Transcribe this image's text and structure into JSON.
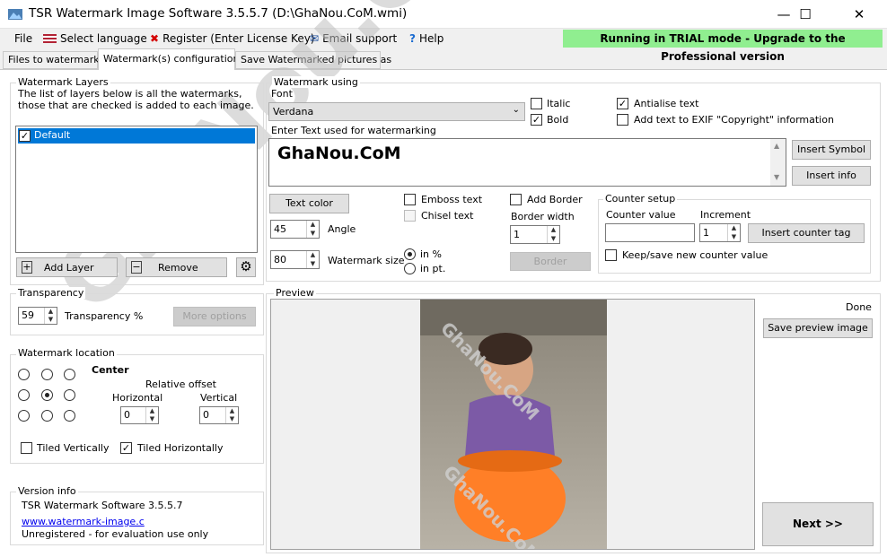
{
  "window": {
    "title": "TSR Watermark Image Software 3.5.5.7 (D:\\GhaNou.CoM.wmi)",
    "minimize": "—",
    "maximize": "☐",
    "close": "✕"
  },
  "menu": {
    "file": "File",
    "select_language": "Select language",
    "register": "Register (Enter License Key)",
    "email_support": "Email support",
    "help": "Help",
    "trial": "Running in TRIAL mode - Upgrade to the Professional version"
  },
  "tabs": [
    "Files to watermark",
    "Watermark(s) configuration",
    "Save Watermarked pictures as"
  ],
  "layers": {
    "group_label": "Watermark Layers",
    "description": "The list of layers below is all the watermarks, those that are checked is added to each image.",
    "items": [
      {
        "label": "Default",
        "checked": true
      }
    ],
    "add_layer": "Add Layer",
    "remove": "Remove"
  },
  "transparency": {
    "group_label": "Transparency",
    "value": "59",
    "label": "Transparency %",
    "more_options": "More options"
  },
  "location": {
    "group_label": "Watermark location",
    "position": "Center",
    "relative_offset": "Relative offset",
    "horizontal_label": "Horizontal",
    "horizontal_value": "0",
    "vertical_label": "Vertical",
    "vertical_value": "0",
    "tiled_vertically": "Tiled Vertically",
    "tiled_horizontally": "Tiled Horizontally"
  },
  "version": {
    "group_label": "Version info",
    "name": "TSR Watermark Software 3.5.5.7",
    "link": "www.watermark-image.c",
    "status": "Unregistered - for evaluation use only"
  },
  "using": {
    "group_label": "Watermark using",
    "font_label": "Font",
    "font_value": "Verdana",
    "italic": "Italic",
    "bold": "Bold",
    "antialise": "Antialise text",
    "exif": "Add text to EXIF \"Copyright\" information",
    "enter_text_label": "Enter Text used for watermarking",
    "text_value": "GhaNou.CoM",
    "insert_symbol": "Insert Symbol",
    "insert_info": "Insert info",
    "text_color": "Text color",
    "angle_value": "45",
    "angle_label": "Angle",
    "size_value": "80",
    "size_label": "Watermark size",
    "emboss": "Emboss text",
    "chisel": "Chisel text",
    "in_percent": "in %",
    "in_pt": "in pt.",
    "add_border": "Add Border",
    "border_width_label": "Border width",
    "border_width_value": "1",
    "border_button": "Border"
  },
  "counter": {
    "group_label": "Counter setup",
    "counter_value_label": "Counter value",
    "counter_value": "",
    "increment_label": "Increment",
    "increment_value": "1",
    "insert_tag": "Insert counter tag",
    "keep": "Keep/save new counter value"
  },
  "preview": {
    "group_label": "Preview",
    "status": "Done",
    "save_preview": "Save preview image",
    "next": "Next >>",
    "overlay_text": "GhaNou.CoM"
  },
  "background_watermark": "GhaNou.CoM",
  "colors": {
    "trial_bg": "#90ee90",
    "selection": "#0078d7",
    "bucket": "#ff7f27"
  }
}
